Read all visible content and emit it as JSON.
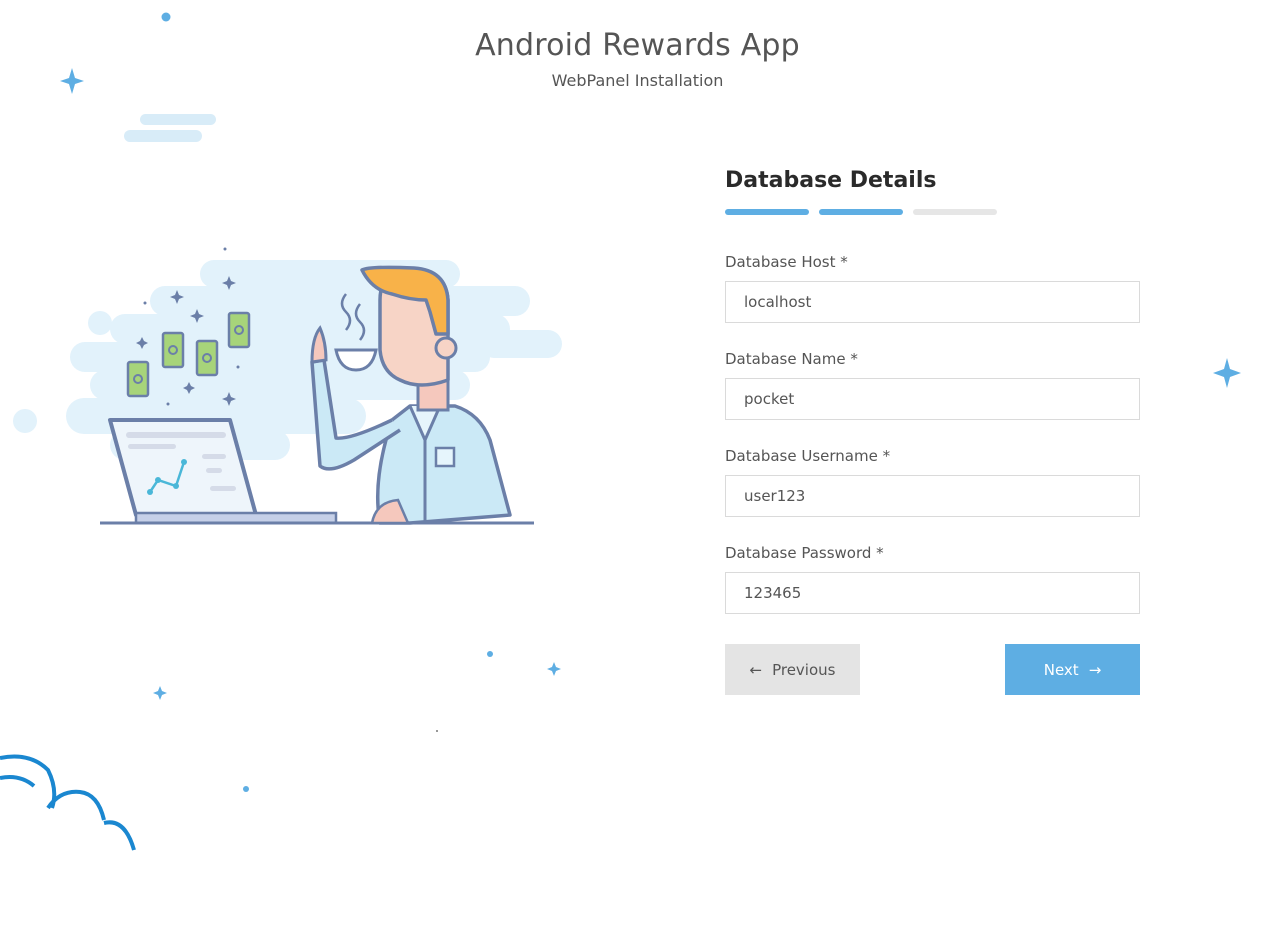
{
  "header": {
    "title": "Android Rewards App",
    "subtitle": "WebPanel Installation"
  },
  "form": {
    "title": "Database Details",
    "steps": [
      {
        "state": "active"
      },
      {
        "state": "active"
      },
      {
        "state": "inactive"
      }
    ],
    "fields": [
      {
        "label": "Database Host *",
        "value": "localhost"
      },
      {
        "label": "Database Name *",
        "value": "pocket"
      },
      {
        "label": "Database Username *",
        "value": "user123"
      },
      {
        "label": "Database Password *",
        "value": "123465"
      }
    ],
    "previous_label": "Previous",
    "next_label": "Next"
  },
  "colors": {
    "accent": "#5eaee3",
    "button_secondary": "#e4e4e4"
  },
  "icons": {
    "previous": "arrow-left-icon",
    "next": "arrow-right-icon",
    "illustration": "man-drinking-coffee-with-laptop-illustration"
  }
}
